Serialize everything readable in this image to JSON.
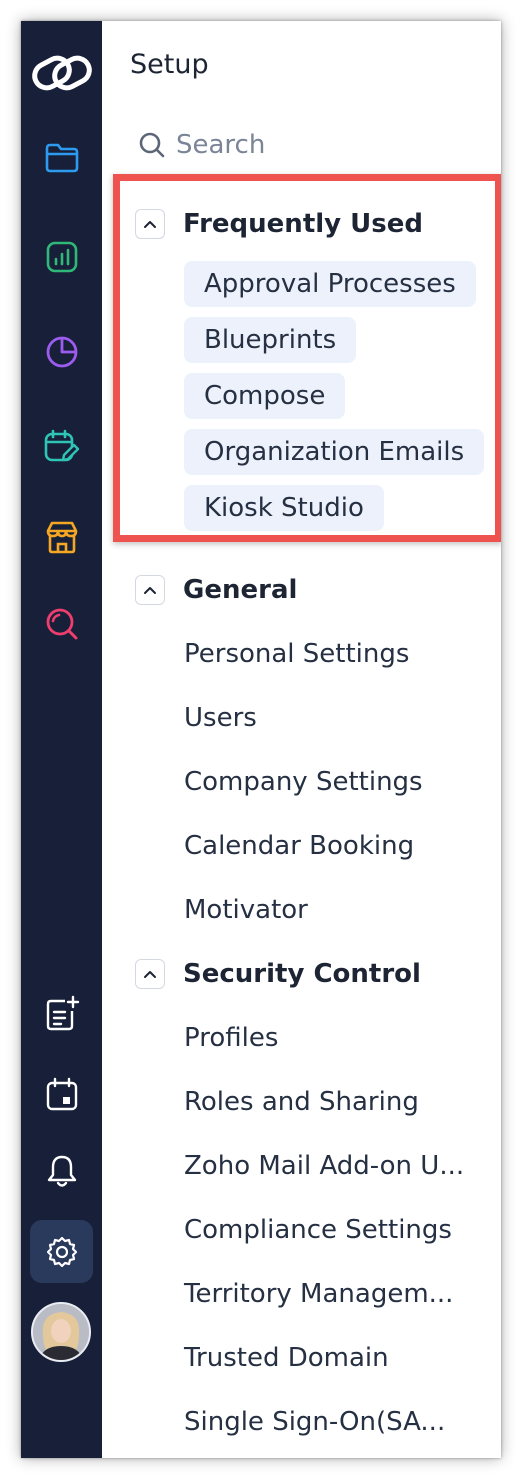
{
  "sidebar": {
    "title": "Setup",
    "search_placeholder": "Search"
  },
  "rail": {
    "icons": [
      {
        "name": "zoho-logo-icon",
        "color": "#ffffff"
      },
      {
        "name": "folder-icon",
        "color": "#2f9bf0"
      },
      {
        "name": "bar-chart-icon",
        "color": "#2fb878"
      },
      {
        "name": "pie-chart-icon",
        "color": "#9c5cf0"
      },
      {
        "name": "calendar-edit-icon",
        "color": "#2ec4b6"
      },
      {
        "name": "store-icon",
        "color": "#f5a623"
      },
      {
        "name": "search-analytics-icon",
        "color": "#ef3d6e"
      },
      {
        "name": "add-note-icon",
        "color": "#ffffff"
      },
      {
        "name": "calendar-icon",
        "color": "#ffffff"
      },
      {
        "name": "bell-icon",
        "color": "#ffffff"
      },
      {
        "name": "gear-icon",
        "color": "#ffffff",
        "active": true
      },
      {
        "name": "avatar",
        "color": "#c9cbd1"
      }
    ]
  },
  "sections": {
    "frequently_used": {
      "title": "Frequently Used",
      "items": [
        "Approval Processes",
        "Blueprints",
        "Compose",
        "Organization Emails",
        "Kiosk Studio"
      ]
    },
    "general": {
      "title": "General",
      "items": [
        "Personal Settings",
        "Users",
        "Company Settings",
        "Calendar Booking",
        "Motivator"
      ]
    },
    "security_control": {
      "title": "Security Control",
      "items": [
        "Profiles",
        "Roles and Sharing",
        "Zoho Mail Add-on U...",
        "Compliance Settings",
        "Territory Managem...",
        "Trusted Domain",
        "Single Sign-On(SA..."
      ]
    }
  },
  "colors": {
    "rail_bg": "#172038",
    "chip_bg": "#ecf1fb",
    "highlight": "#ef5350"
  }
}
